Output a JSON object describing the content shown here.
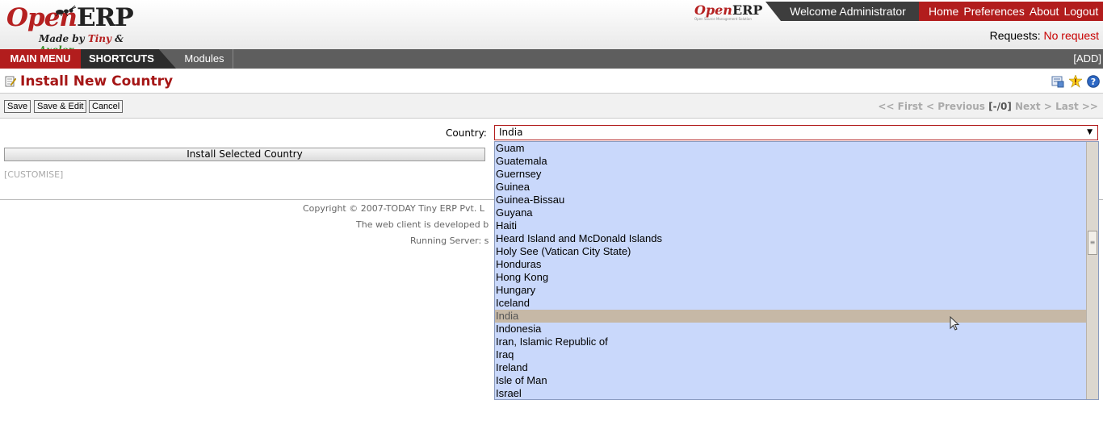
{
  "header": {
    "logo": {
      "main": "Open",
      "erp": "ERP",
      "sub_prefix": "Made by ",
      "sub_tiny": "Tiny",
      "sub_amp": " & ",
      "sub_axelor": "Axelor"
    },
    "mini_logo": {
      "main": "Open",
      "erp": "ERP",
      "tagline": "Open Source Management Solution"
    },
    "welcome": "Welcome Administrator",
    "links": [
      "Home",
      "Preferences",
      "About",
      "Logout"
    ],
    "requests_label": "Requests:",
    "requests_value": "No request"
  },
  "menubar": {
    "main_menu": "MAIN MENU",
    "shortcuts": "SHORTCUTS",
    "modules": "Modules",
    "add": "[ADD]"
  },
  "page": {
    "title": "Install New Country"
  },
  "toolbar": {
    "save": "Save",
    "save_edit": "Save & Edit",
    "cancel": "Cancel",
    "pager": {
      "first": "<< First",
      "previous": "< Previous",
      "count": "[-/0]",
      "next": "Next >",
      "last": "Last >>"
    }
  },
  "form": {
    "country_label": "Country:",
    "country_value": "India",
    "install_button": "Install Selected Country",
    "customise": "[CUSTOMISE]"
  },
  "footer": {
    "copyright": "Copyright © 2007-TODAY Tiny ERP Pvt. L",
    "developed": "The web client is developed b",
    "server": "Running Server: s"
  },
  "dropdown": {
    "options": [
      "Guam",
      "Guatemala",
      "Guernsey",
      "Guinea",
      "Guinea-Bissau",
      "Guyana",
      "Haiti",
      "Heard Island and McDonald Islands",
      "Holy See (Vatican City State)",
      "Honduras",
      "Hong Kong",
      "Hungary",
      "Iceland",
      "India",
      "Indonesia",
      "Iran, Islamic Republic of",
      "Iraq",
      "Ireland",
      "Isle of Man",
      "Israel"
    ],
    "selected": "India"
  },
  "icons": {
    "title_icon": "edit-form-icon",
    "toolbar_icons": [
      "view-list-icon",
      "warning-icon",
      "help-icon"
    ]
  },
  "colors": {
    "brand_red": "#b21d1d",
    "dropdown_bg": "#c9d8fb",
    "selected_option": "#c6b8a6"
  }
}
